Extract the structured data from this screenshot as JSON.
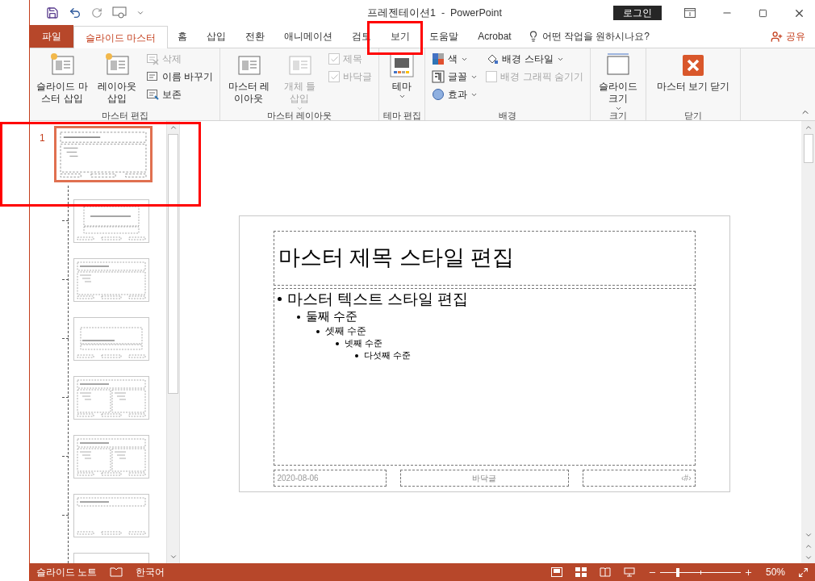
{
  "window": {
    "title": "프레젠테이션1  -  PowerPoint",
    "login": "로그인"
  },
  "tabs": [
    {
      "label": "파일",
      "kind": "file",
      "selected": false
    },
    {
      "label": "슬라이드 마스터",
      "kind": "tab",
      "selected": true
    },
    {
      "label": "홈",
      "kind": "tab",
      "selected": false
    },
    {
      "label": "삽입",
      "kind": "tab",
      "selected": false
    },
    {
      "label": "전환",
      "kind": "tab",
      "selected": false
    },
    {
      "label": "애니메이션",
      "kind": "tab",
      "selected": false
    },
    {
      "label": "검토",
      "kind": "tab",
      "selected": false
    },
    {
      "label": "보기",
      "kind": "tab",
      "selected": false
    },
    {
      "label": "도움말",
      "kind": "tab",
      "selected": false
    },
    {
      "label": "Acrobat",
      "kind": "tab",
      "selected": false
    }
  ],
  "tell_me": "어떤 작업을 원하시나요?",
  "share": "공유",
  "ribbon": [
    {
      "label": "마스터 편집",
      "items": [
        {
          "kind": "large",
          "label": "슬라이드 마스터 삽입",
          "disabled": false,
          "menu": false
        },
        {
          "kind": "large",
          "label": "레이아웃 삽입",
          "disabled": false,
          "menu": false
        },
        {
          "kind": "column",
          "items": [
            {
              "kind": "small",
              "label": "삭제",
              "disabled": true,
              "menu": false
            },
            {
              "kind": "small",
              "label": "이름 바꾸기",
              "disabled": false,
              "menu": false
            },
            {
              "kind": "small",
              "label": "보존",
              "disabled": false,
              "menu": false
            }
          ]
        }
      ]
    },
    {
      "label": "마스터 레이아웃",
      "items": [
        {
          "kind": "large",
          "label": "마스터 레이아웃",
          "disabled": false,
          "menu": false
        },
        {
          "kind": "large",
          "label": "개체 틀 삽입",
          "disabled": true,
          "menu": true
        },
        {
          "kind": "column",
          "items": [
            {
              "kind": "check",
              "label": "제목",
              "disabled": true,
              "checked": true
            },
            {
              "kind": "check",
              "label": "바닥글",
              "disabled": true,
              "checked": true
            }
          ]
        }
      ]
    },
    {
      "label": "테마 편집",
      "items": [
        {
          "kind": "large",
          "label": "테마",
          "disabled": false,
          "menu": true
        }
      ]
    },
    {
      "label": "배경",
      "items": [
        {
          "kind": "column",
          "items": [
            {
              "kind": "small",
              "label": "색",
              "disabled": false,
              "menu": true
            },
            {
              "kind": "small",
              "label": "글꼴",
              "disabled": false,
              "menu": true
            },
            {
              "kind": "small",
              "label": "효과",
              "disabled": false,
              "menu": true
            }
          ]
        },
        {
          "kind": "column",
          "items": [
            {
              "kind": "small",
              "label": "배경 스타일",
              "disabled": false,
              "menu": true
            },
            {
              "kind": "check",
              "label": "배경 그래픽 숨기기",
              "disabled": true,
              "checked": false
            }
          ]
        }
      ]
    },
    {
      "label": "크기",
      "items": [
        {
          "kind": "large",
          "label": "슬라이드 크기",
          "disabled": false,
          "menu": true
        }
      ]
    },
    {
      "label": "닫기",
      "items": [
        {
          "kind": "large",
          "label": "마스터 보기 닫기",
          "disabled": false,
          "menu": false
        }
      ]
    }
  ],
  "thumbnails": [
    {
      "number": "1",
      "kind": "master",
      "selected": true
    },
    {
      "kind": "title-slide",
      "selected": false
    },
    {
      "kind": "title-content",
      "selected": false
    },
    {
      "kind": "section",
      "selected": false
    },
    {
      "kind": "two-content",
      "selected": false
    },
    {
      "kind": "comparison",
      "selected": false
    },
    {
      "kind": "title-only",
      "selected": false
    },
    {
      "kind": "blank",
      "selected": false
    }
  ],
  "slide": {
    "title": "마스터 제목 스타일 편집",
    "bullets": [
      {
        "text": "마스터 텍스트 스타일 편집",
        "children": [
          {
            "text": "둘째 수준",
            "children": [
              {
                "text": "셋째 수준",
                "children": [
                  {
                    "text": "넷째 수준",
                    "children": [
                      {
                        "text": "다섯째 수준"
                      }
                    ]
                  }
                ]
              }
            ]
          }
        ]
      }
    ],
    "footer": {
      "date": "2020-08-06",
      "text": "바닥글",
      "number": "‹#›"
    }
  },
  "status_bar": {
    "notes": "슬라이드 노트",
    "language": "한국어",
    "zoom": {
      "level": 0.22,
      "reading": "50%"
    }
  }
}
